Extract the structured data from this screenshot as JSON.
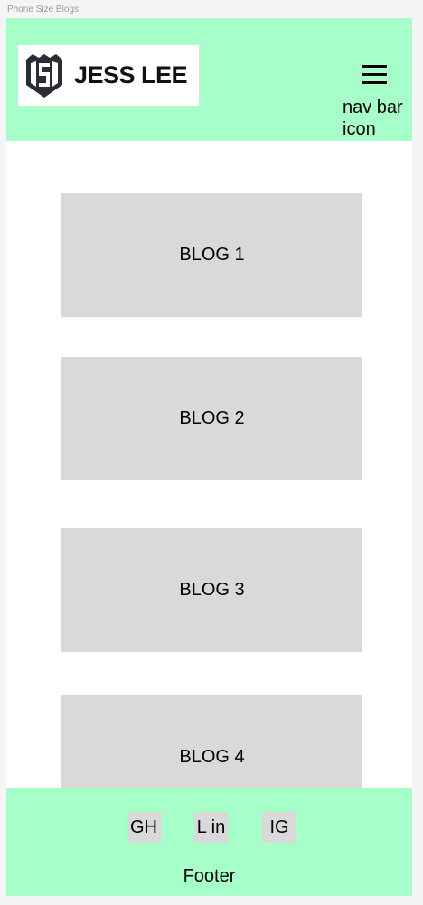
{
  "frame_label": "Phone Size Blogs",
  "header": {
    "logo_text": "JESS LEE",
    "nav_icon_label": "nav bar icon"
  },
  "blogs": [
    {
      "label": "BLOG 1"
    },
    {
      "label": "BLOG 2"
    },
    {
      "label": "BLOG 3"
    },
    {
      "label": "BLOG 4"
    }
  ],
  "footer": {
    "links": [
      {
        "label": "GH"
      },
      {
        "label": "L in"
      },
      {
        "label": "IG"
      }
    ],
    "label": "Footer"
  },
  "colors": {
    "header_bg": "#a6ffc8",
    "footer_bg": "#a6ffc8",
    "placeholder_bg": "#d9d9d9",
    "page_bg": "#f5f5f5"
  }
}
